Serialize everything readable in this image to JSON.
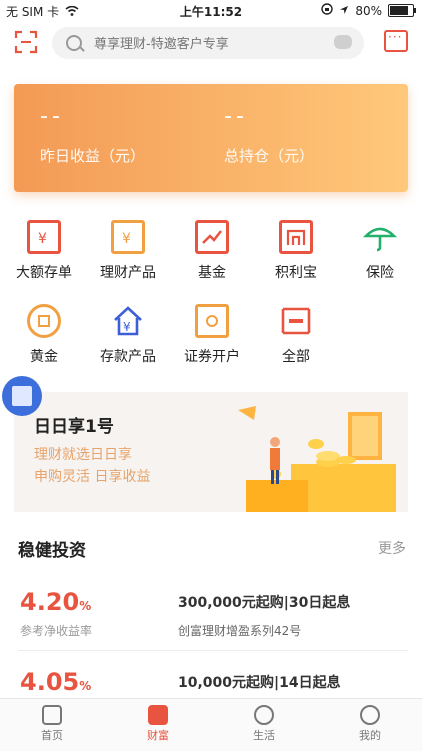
{
  "status_bar": {
    "carrier": "无 SIM 卡",
    "time": "上午11:52",
    "battery": "80%",
    "battery_level": 0.8
  },
  "search": {
    "placeholder": "尊享理财-特邀客户专享"
  },
  "earnings": {
    "yesterday": {
      "value": "--",
      "label": "昨日收益（元）"
    },
    "total": {
      "value": "--",
      "label": "总持仓（元）"
    }
  },
  "categories": [
    {
      "label": "大额存单",
      "icon": "certificate-icon",
      "color": "#e8543f"
    },
    {
      "label": "理财产品",
      "icon": "wealth-box-icon",
      "color": "#f0a040"
    },
    {
      "label": "基金",
      "icon": "chart-up-icon",
      "color": "#e8543f"
    },
    {
      "label": "积利宝",
      "icon": "treasure-icon",
      "color": "#e8543f"
    },
    {
      "label": "保险",
      "icon": "umbrella-icon",
      "color": "#22b06a"
    },
    {
      "label": "黄金",
      "icon": "coin-icon",
      "color": "#f0a040"
    },
    {
      "label": "存款产品",
      "icon": "house-yuan-icon",
      "color": "#3c5fd6"
    },
    {
      "label": "证券开户",
      "icon": "securities-icon",
      "color": "#f0a040"
    },
    {
      "label": "全部",
      "icon": "all-icon",
      "color": "#e8543f"
    }
  ],
  "banner": {
    "title": "日日享1号",
    "line1": "理财就选日日享",
    "line2": "申购灵活  日享收益"
  },
  "section": {
    "title": "稳健投资",
    "more": "更多"
  },
  "products": [
    {
      "rate": "4.20",
      "unit": "%",
      "rate_label": "参考净收益率",
      "condition": "300,000元起购|30日起息",
      "name": "创富理财增盈系列42号"
    },
    {
      "rate": "4.05",
      "unit": "%",
      "rate_label": "",
      "condition": "10,000元起购|14日起息",
      "name": ""
    }
  ],
  "tabs": [
    {
      "label": "首页",
      "icon": "home-icon"
    },
    {
      "label": "财富",
      "icon": "diamond-icon"
    },
    {
      "label": "生活",
      "icon": "lightbulb-icon"
    },
    {
      "label": "我的",
      "icon": "profile-icon"
    }
  ]
}
